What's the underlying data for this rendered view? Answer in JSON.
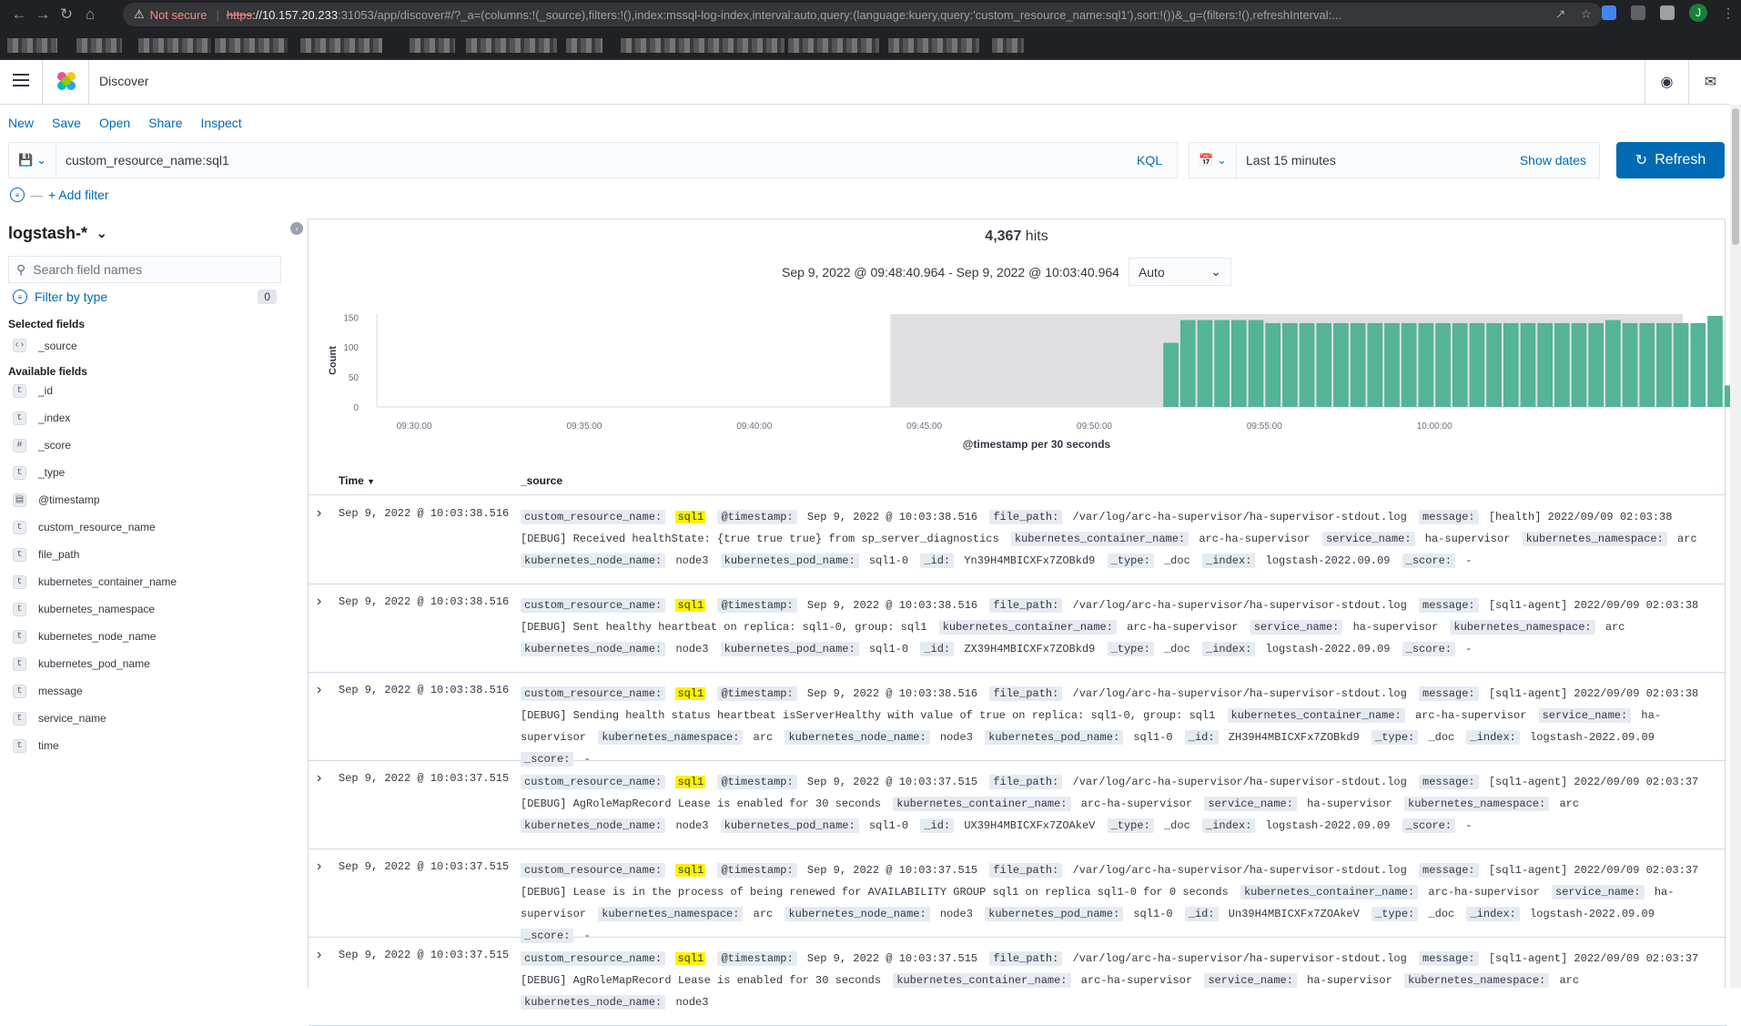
{
  "browser": {
    "not_secure": "Not secure",
    "url_scheme": "https",
    "url_host": "://10.157.20.233",
    "url_path": ":31053/app/discover#/?_a=(columns:!(_source),filters:!(),index:mssql-log-index,interval:auto,query:(language:kuery,query:'custom_resource_name:sql1'),sort:!())&_g=(filters:!(),refreshInterval:...",
    "profile_initial": "J"
  },
  "header": {
    "app_title": "Discover"
  },
  "top_nav": {
    "new": "New",
    "save": "Save",
    "open": "Open",
    "share": "Share",
    "inspect": "Inspect"
  },
  "query": {
    "value": "custom_resource_name:sql1",
    "language": "KQL"
  },
  "date_picker": {
    "label": "Last 15 minutes",
    "show_dates": "Show dates"
  },
  "refresh": {
    "label": "Refresh"
  },
  "filters": {
    "add_filter": "+ Add filter"
  },
  "sidebar": {
    "index_pattern": "logstash-*",
    "search_placeholder": "Search field names",
    "filter_by_type": "Filter by type",
    "filter_count": "0",
    "selected_fields_title": "Selected fields",
    "selected_fields": [
      {
        "name": "_source",
        "type": "source"
      }
    ],
    "available_fields_title": "Available fields",
    "available_fields": [
      {
        "name": "_id",
        "type": "t"
      },
      {
        "name": "_index",
        "type": "t"
      },
      {
        "name": "_score",
        "type": "#"
      },
      {
        "name": "_type",
        "type": "t"
      },
      {
        "name": "@timestamp",
        "type": "date"
      },
      {
        "name": "custom_resource_name",
        "type": "t"
      },
      {
        "name": "file_path",
        "type": "t"
      },
      {
        "name": "kubernetes_container_name",
        "type": "t"
      },
      {
        "name": "kubernetes_namespace",
        "type": "t"
      },
      {
        "name": "kubernetes_node_name",
        "type": "t"
      },
      {
        "name": "kubernetes_pod_name",
        "type": "t"
      },
      {
        "name": "message",
        "type": "t"
      },
      {
        "name": "service_name",
        "type": "t"
      },
      {
        "name": "time",
        "type": "t"
      }
    ]
  },
  "results": {
    "hits_count": "4,367",
    "hits_label": "hits",
    "range_text": "Sep 9, 2022 @ 09:48:40.964 - Sep 9, 2022 @ 10:03:40.964",
    "interval": "Auto"
  },
  "colors": {
    "accent": "#006bb4",
    "bar": "#54b399",
    "highlight": "#fff200"
  },
  "chart_data": {
    "type": "bar",
    "xlabel": "@timestamp per 30 seconds",
    "ylabel": "Count",
    "ylim": [
      0,
      155
    ],
    "y_ticks": [
      0,
      50,
      100,
      150
    ],
    "x_tick_labels": [
      "09:30:00",
      "09:35:00",
      "09:40:00",
      "09:45:00",
      "09:50:00",
      "09:55:00",
      "10:00:00"
    ],
    "x_start_minutes": 0,
    "x_tick_minutes": [
      30,
      35,
      40,
      45,
      50,
      55,
      60
    ],
    "x_domain_minutes": [
      28.9,
      67.3
    ],
    "shaded_range_minutes": [
      44.0,
      67.3
    ],
    "bar_start_minutes": 52.0,
    "bar_width_minutes": 0.5,
    "values": [
      107,
      145,
      145,
      145,
      145,
      145,
      140,
      140,
      140,
      140,
      140,
      140,
      140,
      140,
      140,
      140,
      140,
      140,
      140,
      140,
      140,
      140,
      140,
      140,
      140,
      140,
      145,
      140,
      140,
      140,
      140,
      140,
      152,
      36
    ]
  },
  "table": {
    "col_time": "Time",
    "col_source": "_source",
    "rows": [
      {
        "time": "Sep 9, 2022 @ 10:03:38.516",
        "fields": [
          [
            "custom_resource_name:",
            "sql1",
            true
          ],
          [
            "@timestamp:",
            "Sep 9, 2022 @ 10:03:38.516",
            false
          ],
          [
            "file_path:",
            "/var/log/arc-ha-supervisor/ha-supervisor-stdout.log",
            false
          ],
          [
            "message:",
            "[health] 2022/09/09 02:03:38 [DEBUG] Received healthState: {true true true} from sp_server_diagnostics",
            false
          ],
          [
            "kubernetes_container_name:",
            "arc-ha-supervisor",
            false
          ],
          [
            "service_name:",
            "ha-supervisor",
            false
          ],
          [
            "kubernetes_namespace:",
            "arc",
            false
          ],
          [
            "kubernetes_node_name:",
            "node3",
            false
          ],
          [
            "kubernetes_pod_name:",
            "sql1-0",
            false
          ],
          [
            "_id:",
            "Yn39H4MBICXFx7ZOBkd9",
            false
          ],
          [
            "_type:",
            "_doc",
            false
          ],
          [
            "_index:",
            "logstash-2022.09.09",
            false
          ],
          [
            "_score:",
            " -",
            false
          ]
        ]
      },
      {
        "time": "Sep 9, 2022 @ 10:03:38.516",
        "fields": [
          [
            "custom_resource_name:",
            "sql1",
            true
          ],
          [
            "@timestamp:",
            "Sep 9, 2022 @ 10:03:38.516",
            false
          ],
          [
            "file_path:",
            "/var/log/arc-ha-supervisor/ha-supervisor-stdout.log",
            false
          ],
          [
            "message:",
            "[sql1-agent] 2022/09/09 02:03:38 [DEBUG] Sent healthy heartbeat on replica: sql1-0, group: sql1",
            false
          ],
          [
            "kubernetes_container_name:",
            "arc-ha-supervisor",
            false
          ],
          [
            "service_name:",
            "ha-supervisor",
            false
          ],
          [
            "kubernetes_namespace:",
            "arc",
            false
          ],
          [
            "kubernetes_node_name:",
            "node3",
            false
          ],
          [
            "kubernetes_pod_name:",
            "sql1-0",
            false
          ],
          [
            "_id:",
            "ZX39H4MBICXFx7ZOBkd9",
            false
          ],
          [
            "_type:",
            "_doc",
            false
          ],
          [
            "_index:",
            "logstash-2022.09.09",
            false
          ],
          [
            "_score:",
            " -",
            false
          ]
        ]
      },
      {
        "time": "Sep 9, 2022 @ 10:03:38.516",
        "fields": [
          [
            "custom_resource_name:",
            "sql1",
            true
          ],
          [
            "@timestamp:",
            "Sep 9, 2022 @ 10:03:38.516",
            false
          ],
          [
            "file_path:",
            "/var/log/arc-ha-supervisor/ha-supervisor-stdout.log",
            false
          ],
          [
            "message:",
            "[sql1-agent] 2022/09/09 02:03:38 [DEBUG] Sending health status heartbeat isServerHealthy with value of true on replica: sql1-0, group: sql1",
            false
          ],
          [
            "kubernetes_container_name:",
            "arc-ha-supervisor",
            false
          ],
          [
            "service_name:",
            "ha-supervisor",
            false
          ],
          [
            "kubernetes_namespace:",
            "arc",
            false
          ],
          [
            "kubernetes_node_name:",
            "node3",
            false
          ],
          [
            "kubernetes_pod_name:",
            "sql1-0",
            false
          ],
          [
            "_id:",
            "ZH39H4MBICXFx7ZOBkd9",
            false
          ],
          [
            "_type:",
            "_doc",
            false
          ],
          [
            "_index:",
            "logstash-2022.09.09",
            false
          ],
          [
            "_score:",
            " -",
            false
          ]
        ]
      },
      {
        "time": "Sep 9, 2022 @ 10:03:37.515",
        "fields": [
          [
            "custom_resource_name:",
            "sql1",
            true
          ],
          [
            "@timestamp:",
            "Sep 9, 2022 @ 10:03:37.515",
            false
          ],
          [
            "file_path:",
            "/var/log/arc-ha-supervisor/ha-supervisor-stdout.log",
            false
          ],
          [
            "message:",
            "[sql1-agent] 2022/09/09 02:03:37 [DEBUG] AgRoleMapRecord Lease is enabled for 30 seconds",
            false
          ],
          [
            "kubernetes_container_name:",
            "arc-ha-supervisor",
            false
          ],
          [
            "service_name:",
            "ha-supervisor",
            false
          ],
          [
            "kubernetes_namespace:",
            "arc",
            false
          ],
          [
            "kubernetes_node_name:",
            "node3",
            false
          ],
          [
            "kubernetes_pod_name:",
            "sql1-0",
            false
          ],
          [
            "_id:",
            "UX39H4MBICXFx7ZOAkeV",
            false
          ],
          [
            "_type:",
            "_doc",
            false
          ],
          [
            "_index:",
            "logstash-2022.09.09",
            false
          ],
          [
            "_score:",
            " -",
            false
          ]
        ]
      },
      {
        "time": "Sep 9, 2022 @ 10:03:37.515",
        "fields": [
          [
            "custom_resource_name:",
            "sql1",
            true
          ],
          [
            "@timestamp:",
            "Sep 9, 2022 @ 10:03:37.515",
            false
          ],
          [
            "file_path:",
            "/var/log/arc-ha-supervisor/ha-supervisor-stdout.log",
            false
          ],
          [
            "message:",
            "[sql1-agent] 2022/09/09 02:03:37 [DEBUG] Lease is in the process of being renewed for AVAILABILITY GROUP sql1 on replica sql1-0 for 0 seconds",
            false
          ],
          [
            "kubernetes_container_name:",
            "arc-ha-supervisor",
            false
          ],
          [
            "service_name:",
            "ha-supervisor",
            false
          ],
          [
            "kubernetes_namespace:",
            "arc",
            false
          ],
          [
            "kubernetes_node_name:",
            "node3",
            false
          ],
          [
            "kubernetes_pod_name:",
            "sql1-0",
            false
          ],
          [
            "_id:",
            "Un39H4MBICXFx7ZOAkeV",
            false
          ],
          [
            "_type:",
            "_doc",
            false
          ],
          [
            "_index:",
            "logstash-2022.09.09",
            false
          ],
          [
            "_score:",
            " -",
            false
          ]
        ]
      },
      {
        "time": "Sep 9, 2022 @ 10:03:37.515",
        "fields": [
          [
            "custom_resource_name:",
            "sql1",
            true
          ],
          [
            "@timestamp:",
            "Sep 9, 2022 @ 10:03:37.515",
            false
          ],
          [
            "file_path:",
            "/var/log/arc-ha-supervisor/ha-supervisor-stdout.log",
            false
          ],
          [
            "message:",
            "[sql1-agent] 2022/09/09 02:03:37 [DEBUG] AgRoleMapRecord Lease is enabled for 30 seconds",
            false
          ],
          [
            "kubernetes_container_name:",
            "arc-ha-supervisor",
            false
          ],
          [
            "service_name:",
            "ha-supervisor",
            false
          ],
          [
            "kubernetes_namespace:",
            "arc",
            false
          ],
          [
            "kubernetes_node_name:",
            "node3",
            false
          ]
        ]
      }
    ]
  }
}
